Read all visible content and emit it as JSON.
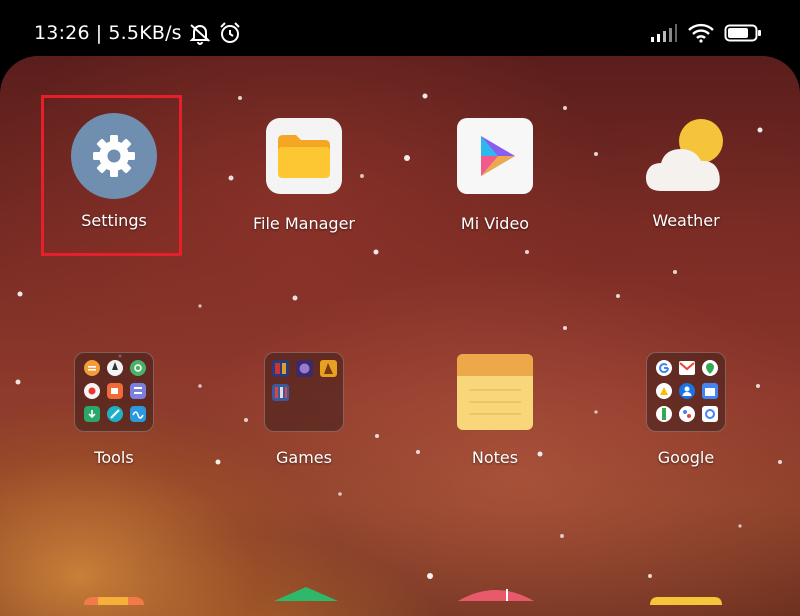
{
  "status_bar": {
    "time": "13:26",
    "separator": "|",
    "speed": "5.5KB/s",
    "icons": [
      "mute-notifications-icon",
      "alarm-icon",
      "signal-icon",
      "wifi-icon",
      "battery-icon"
    ]
  },
  "apps": [
    {
      "label": "Settings",
      "icon": "gear-icon",
      "color": "#6f8eb0"
    },
    {
      "label": "File Manager",
      "icon": "folder-icon",
      "color": "#fbbf2d"
    },
    {
      "label": "Mi Video",
      "icon": "play-icon",
      "color": "#7b5cf0"
    },
    {
      "label": "Weather",
      "icon": "sun-cloud-icon",
      "color": "#f5c43a"
    }
  ],
  "folders": [
    {
      "label": "Tools"
    },
    {
      "label": "Games"
    },
    {
      "label": "Notes"
    },
    {
      "label": "Google"
    }
  ],
  "highlight_color": "#e5202a"
}
